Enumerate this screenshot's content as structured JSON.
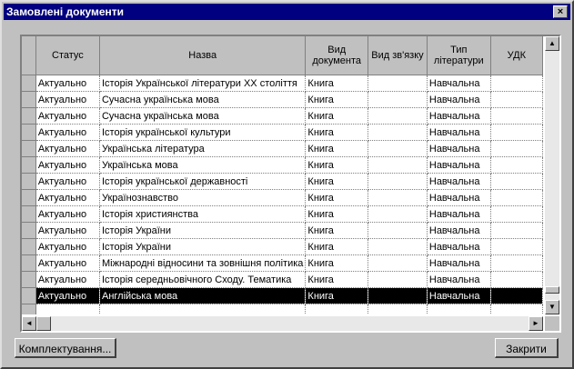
{
  "window": {
    "title": "Замовлені документи",
    "close_label": "×"
  },
  "grid": {
    "columns": [
      "",
      "Статус",
      "Назва",
      "Вид документа",
      "Вид зв'язку",
      "Тип літератури",
      "УДК"
    ],
    "rows": [
      [
        "Актуально",
        "Історія Української літератури XX століття",
        "Книга",
        "",
        "Навчальна",
        ""
      ],
      [
        "Актуально",
        "Сучасна українська мова",
        "Книга",
        "",
        "Навчальна",
        ""
      ],
      [
        "Актуально",
        "Сучасна українська мова",
        "Книга",
        "",
        "Навчальна",
        ""
      ],
      [
        "Актуально",
        "Історія української культури",
        "Книга",
        "",
        "Навчальна",
        ""
      ],
      [
        "Актуально",
        "Українська література",
        "Книга",
        "",
        "Навчальна",
        ""
      ],
      [
        "Актуально",
        "Українська мова",
        "Книга",
        "",
        "Навчальна",
        ""
      ],
      [
        "Актуально",
        "Історія української державності",
        "Книга",
        "",
        "Навчальна",
        ""
      ],
      [
        "Актуально",
        "Українознавство",
        "Книга",
        "",
        "Навчальна",
        ""
      ],
      [
        "Актуально",
        "Історія християнства",
        "Книга",
        "",
        "Навчальна",
        ""
      ],
      [
        "Актуально",
        "Історія України",
        "Книга",
        "",
        "Навчальна",
        ""
      ],
      [
        "Актуально",
        "Історія України",
        "Книга",
        "",
        "Навчальна",
        ""
      ],
      [
        "Актуально",
        "Міжнародні відносини та зовнішня політика",
        "Книга",
        "",
        "Навчальна",
        ""
      ],
      [
        "Актуально",
        "Історія середньовічного Сходу. Тематика",
        "Книга",
        "",
        "Навчальна",
        ""
      ],
      [
        "Актуально",
        "Англійська мова",
        "Книга",
        "",
        "Навчальна",
        ""
      ],
      [
        "",
        "",
        "",
        "",
        "",
        ""
      ]
    ],
    "selected_row": 13
  },
  "buttons": {
    "complete": "Комплектування...",
    "close": "Закрити"
  },
  "scroll": {
    "up": "▲",
    "down": "▼",
    "left": "◄",
    "right": "►"
  }
}
